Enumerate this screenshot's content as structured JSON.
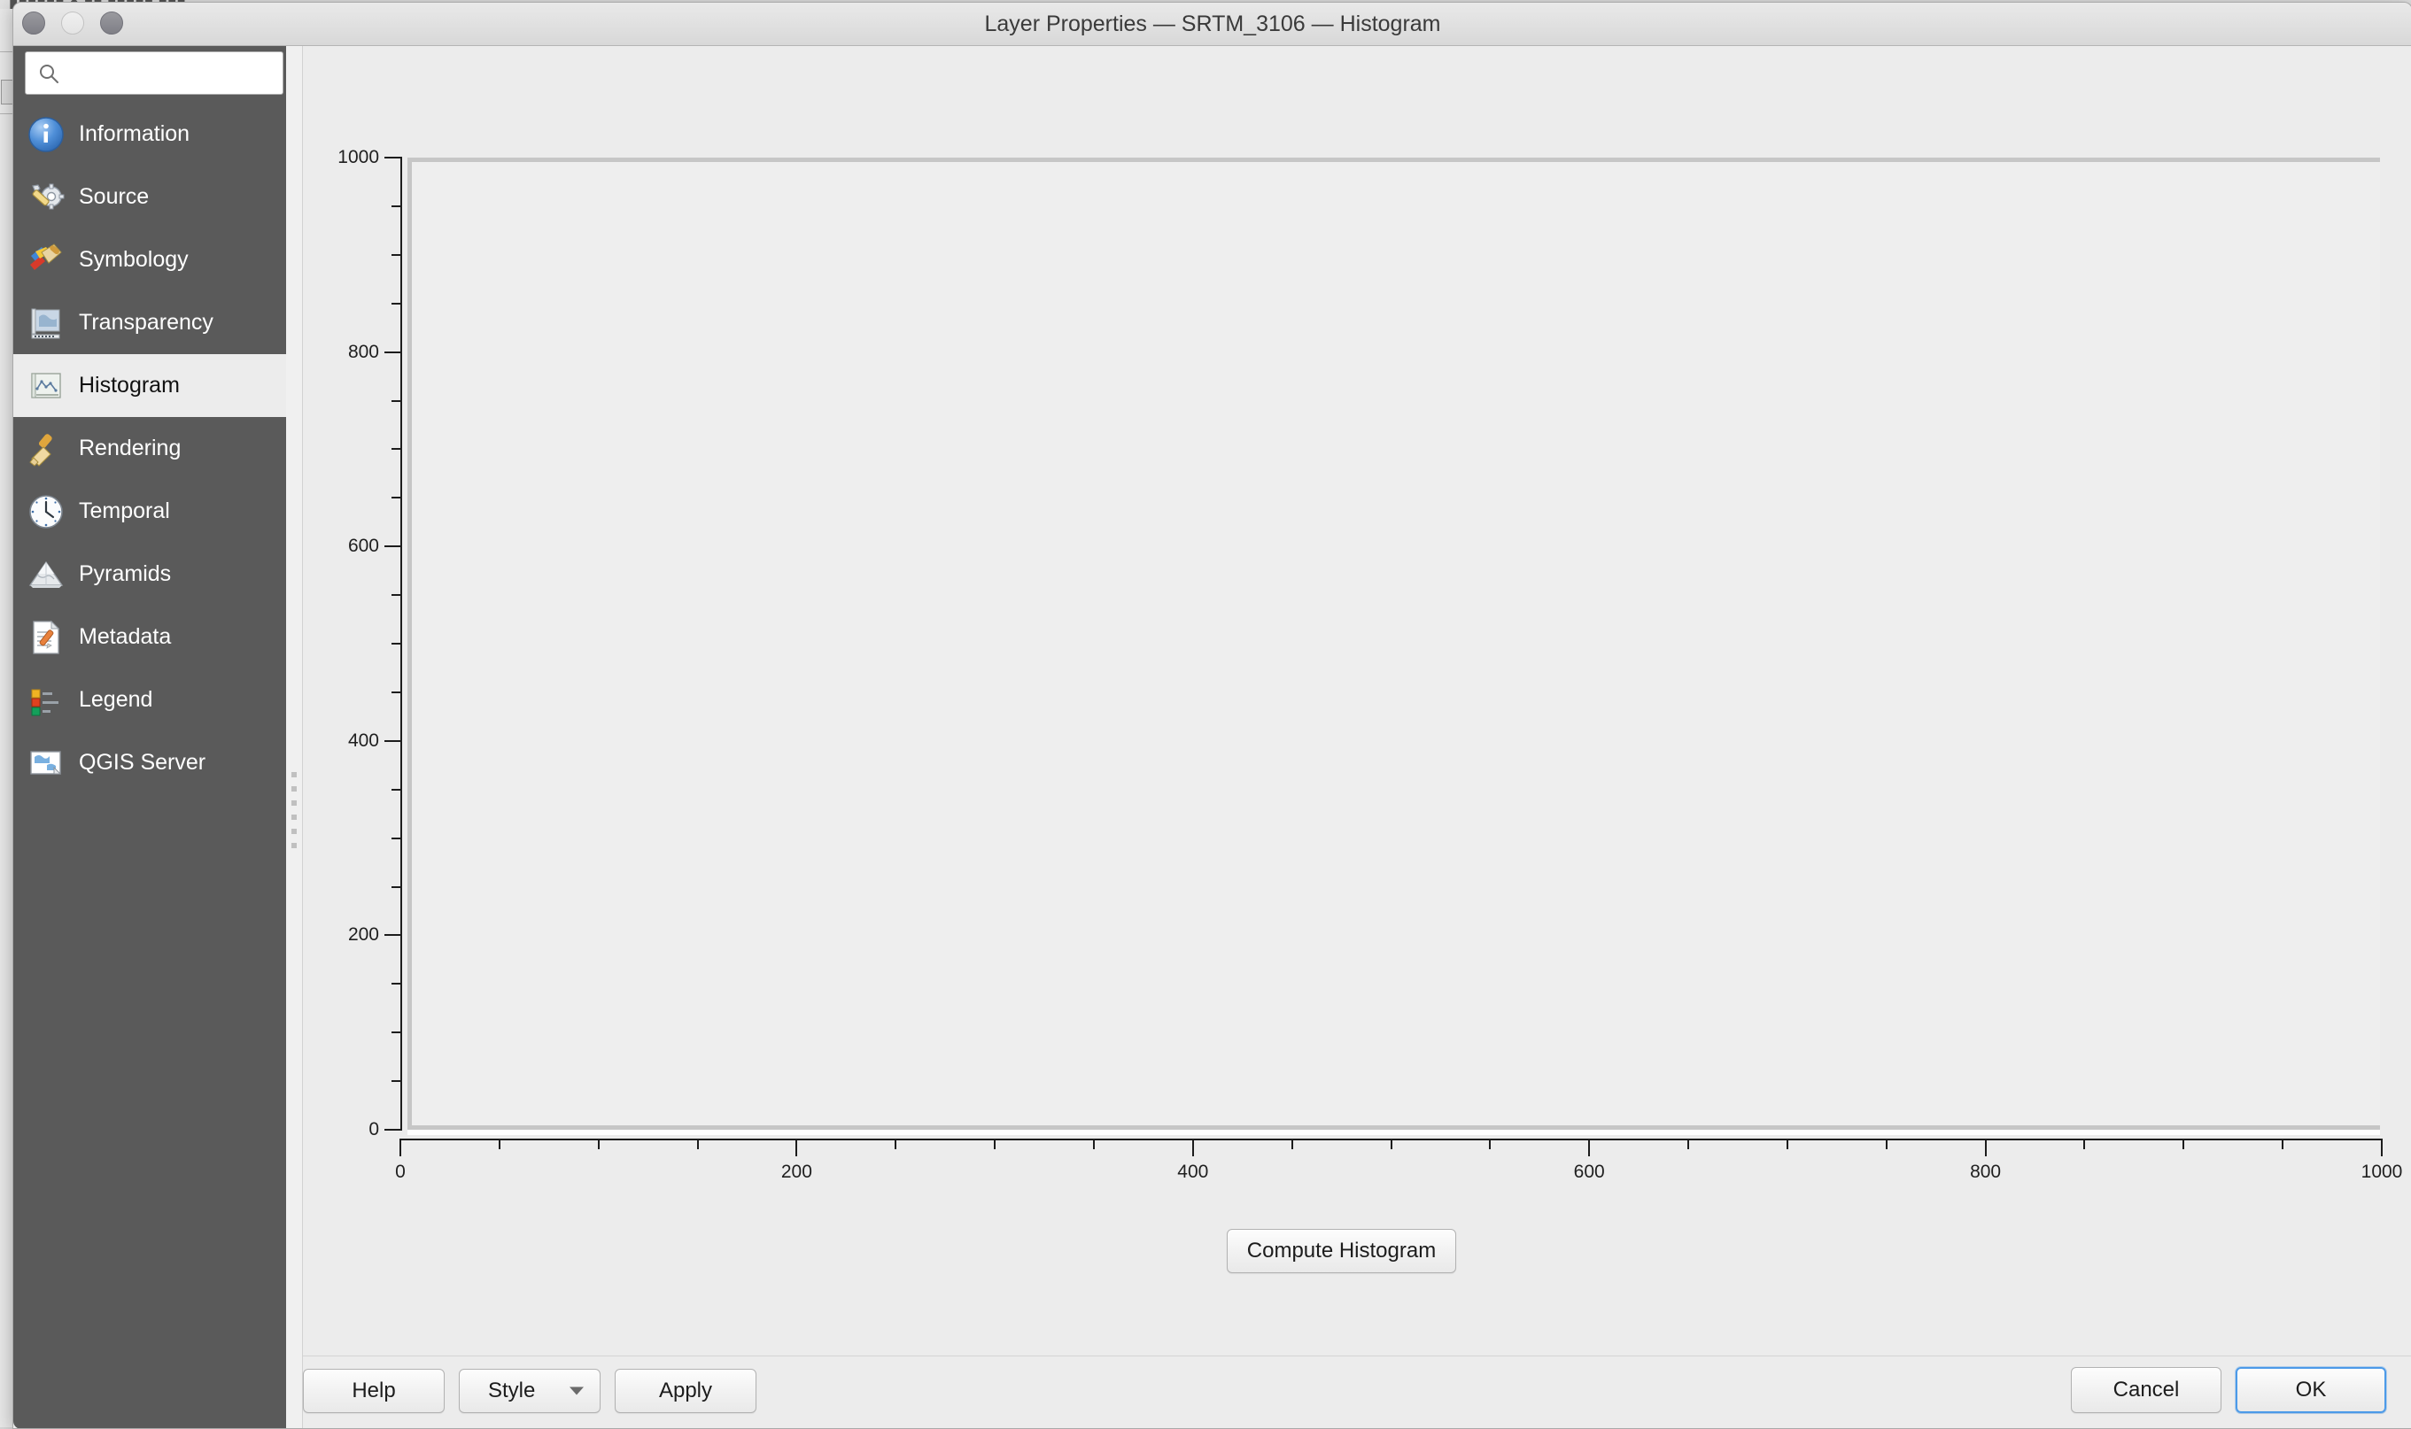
{
  "window": {
    "title": "Layer Properties — SRTM_3106 — Histogram",
    "controls": {
      "close": "close-button",
      "minimize": "minimize-button",
      "zoom": "zoom-button"
    }
  },
  "background": {
    "menu_ghost": "▮▮▮▮▮▮   ●   ▮▮ ▮▮▮▮▮ ▮▮▮"
  },
  "search": {
    "value": "",
    "placeholder": "",
    "icon": "search-icon"
  },
  "sidebar": {
    "items": [
      {
        "label": "Information",
        "icon": "information-icon",
        "selected": false
      },
      {
        "label": "Source",
        "icon": "source-icon",
        "selected": false
      },
      {
        "label": "Symbology",
        "icon": "symbology-icon",
        "selected": false
      },
      {
        "label": "Transparency",
        "icon": "transparency-icon",
        "selected": false
      },
      {
        "label": "Histogram",
        "icon": "histogram-icon",
        "selected": true
      },
      {
        "label": "Rendering",
        "icon": "rendering-icon",
        "selected": false
      },
      {
        "label": "Temporal",
        "icon": "temporal-icon",
        "selected": false
      },
      {
        "label": "Pyramids",
        "icon": "pyramids-icon",
        "selected": false
      },
      {
        "label": "Metadata",
        "icon": "metadata-icon",
        "selected": false
      },
      {
        "label": "Legend",
        "icon": "legend-icon",
        "selected": false
      },
      {
        "label": "QGIS Server",
        "icon": "qgis-server-icon",
        "selected": false
      }
    ]
  },
  "main": {
    "compute_label": "Compute Histogram"
  },
  "footer": {
    "help_label": "Help",
    "style_label": "Style",
    "apply_label": "Apply",
    "cancel_label": "Cancel",
    "ok_label": "OK"
  },
  "colors": {
    "sidebar_bg": "#5a5a5a",
    "panel_bg": "#ececec",
    "selected_bg": "#ececec",
    "accent_focus": "#4c9ae8",
    "axis": "#1c1c1c",
    "plot_frame": "#c6c6c6"
  },
  "chart_data": {
    "type": "bar",
    "title": "",
    "xlabel": "",
    "ylabel": "",
    "xlim": [
      0,
      1000
    ],
    "ylim": [
      0,
      1000
    ],
    "x_ticks": [
      0,
      200,
      400,
      600,
      800,
      1000
    ],
    "x_tick_labels": [
      "0",
      "200",
      "400",
      "600",
      "800",
      "1000"
    ],
    "x_minor_step": 50,
    "y_ticks": [
      0,
      200,
      400,
      600,
      800,
      1000
    ],
    "y_tick_labels": [
      "0",
      "200",
      "400",
      "600",
      "800",
      "1000"
    ],
    "y_minor_step": 50,
    "grid": false,
    "legend": null,
    "categories": [],
    "values": [],
    "series": [],
    "note": "Histogram not yet computed — plot area is empty"
  }
}
